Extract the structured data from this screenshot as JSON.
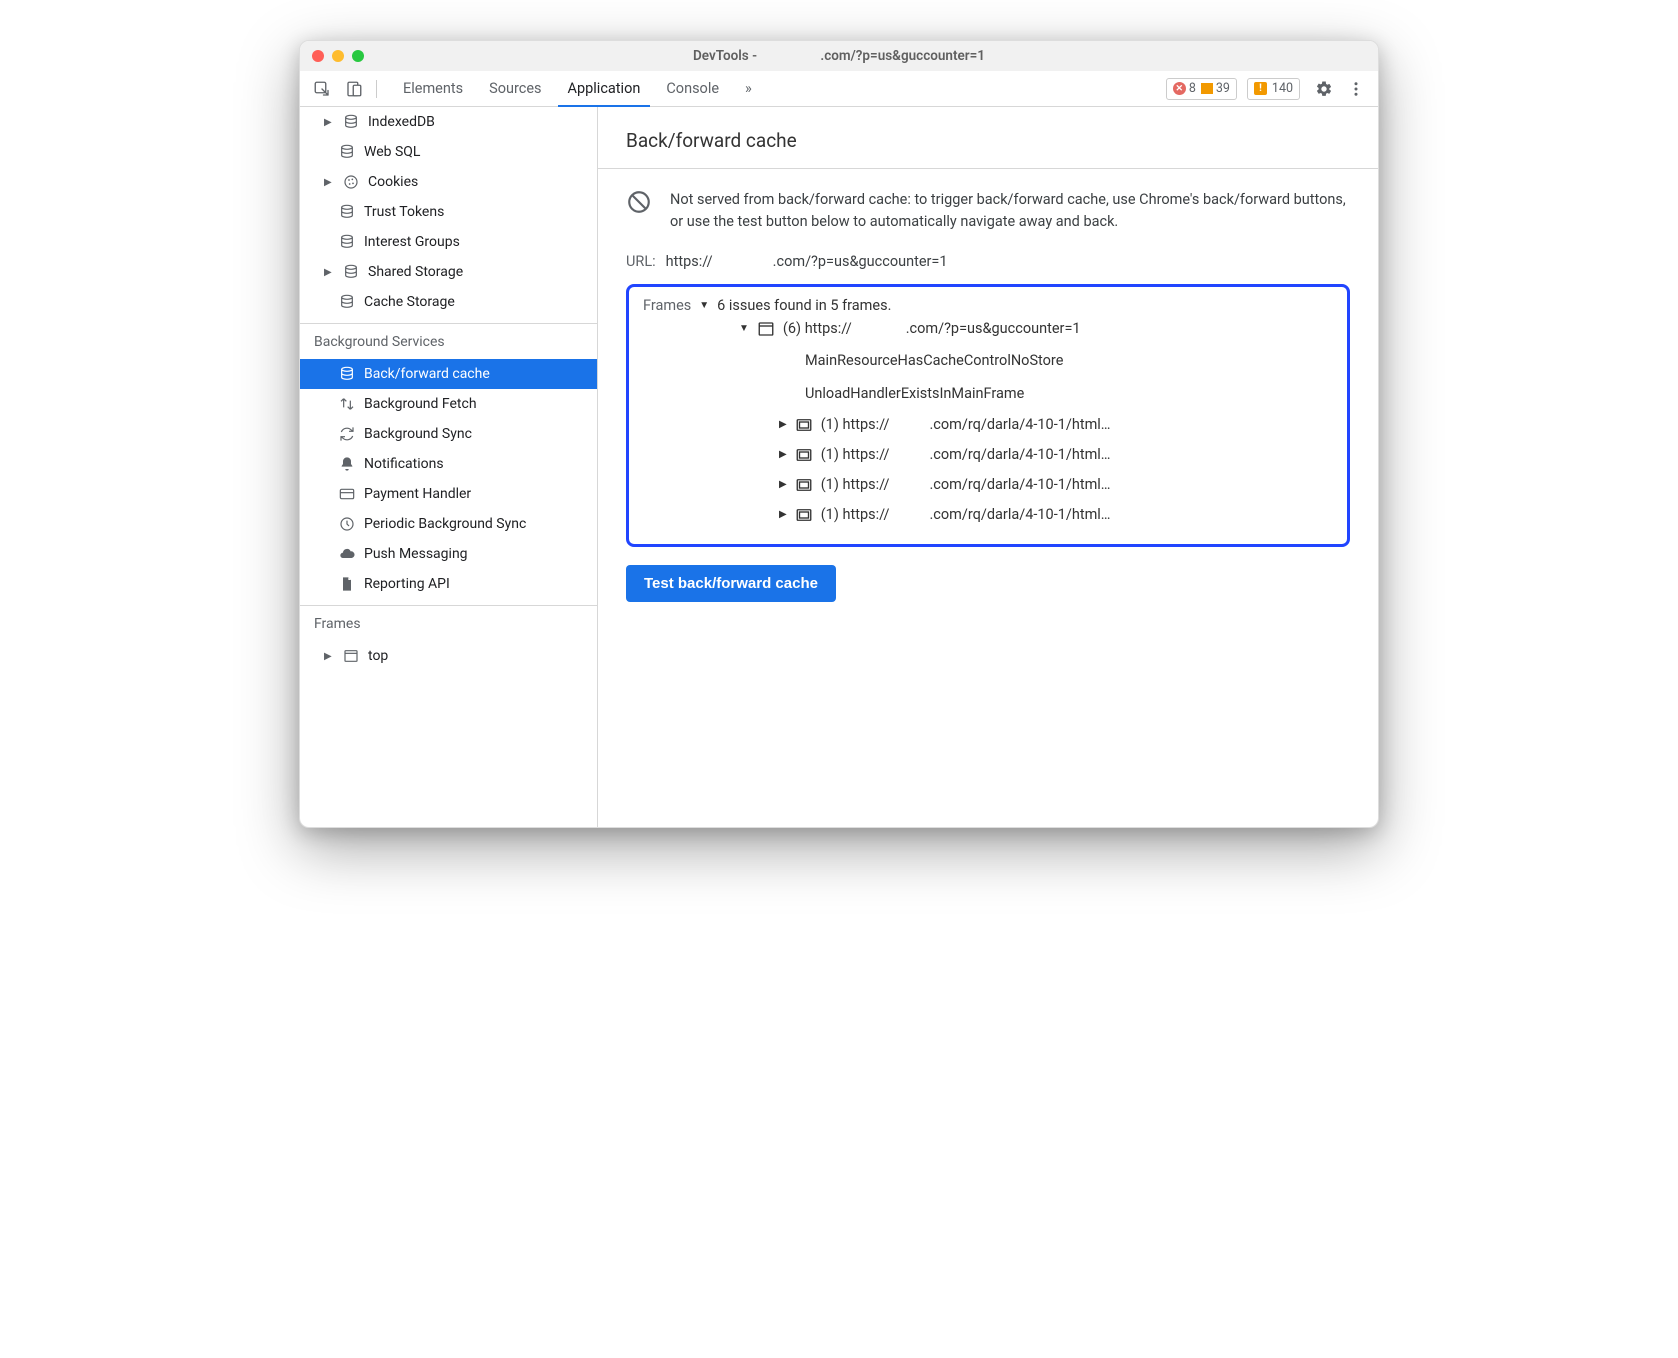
{
  "window": {
    "title_prefix": "DevTools - ",
    "title_suffix": ".com/?p=us&guccounter=1"
  },
  "toolbar": {
    "tabs": {
      "elements": "Elements",
      "sources": "Sources",
      "application": "Application",
      "console": "Console"
    },
    "errors": "8",
    "warnings": "39",
    "issues": "140"
  },
  "sidebar": {
    "storage": {
      "indexeddb": "IndexedDB",
      "websql": "Web SQL",
      "cookies": "Cookies",
      "trust_tokens": "Trust Tokens",
      "interest_groups": "Interest Groups",
      "shared_storage": "Shared Storage",
      "cache_storage": "Cache Storage"
    },
    "bg_header": "Background Services",
    "bg": {
      "bfcache": "Back/forward cache",
      "bg_fetch": "Background Fetch",
      "bg_sync": "Background Sync",
      "notifications": "Notifications",
      "payment": "Payment Handler",
      "periodic": "Periodic Background Sync",
      "push": "Push Messaging",
      "reporting": "Reporting API"
    },
    "frames_header": "Frames",
    "frames_top": "top"
  },
  "panel": {
    "title": "Back/forward cache",
    "info": "Not served from back/forward cache: to trigger back/forward cache, use Chrome's back/forward buttons, or use the test button below to automatically navigate away and back.",
    "url_label": "URL:",
    "url_head": "https://",
    "url_tail": ".com/?p=us&guccounter=1",
    "frames_label": "Frames",
    "frames_summary": "6 issues found in 5 frames.",
    "top_frame_count": "(6)",
    "top_frame_head": "https://",
    "top_frame_tail": ".com/?p=us&guccounter=1",
    "reason1": "MainResourceHasCacheControlNoStore",
    "reason2": "UnloadHandlerExistsInMainFrame",
    "sub_count": "(1)",
    "sub_head": "https://",
    "sub_tail": ".com/rq/darla/4-10-1/html…",
    "test_button": "Test back/forward cache"
  }
}
